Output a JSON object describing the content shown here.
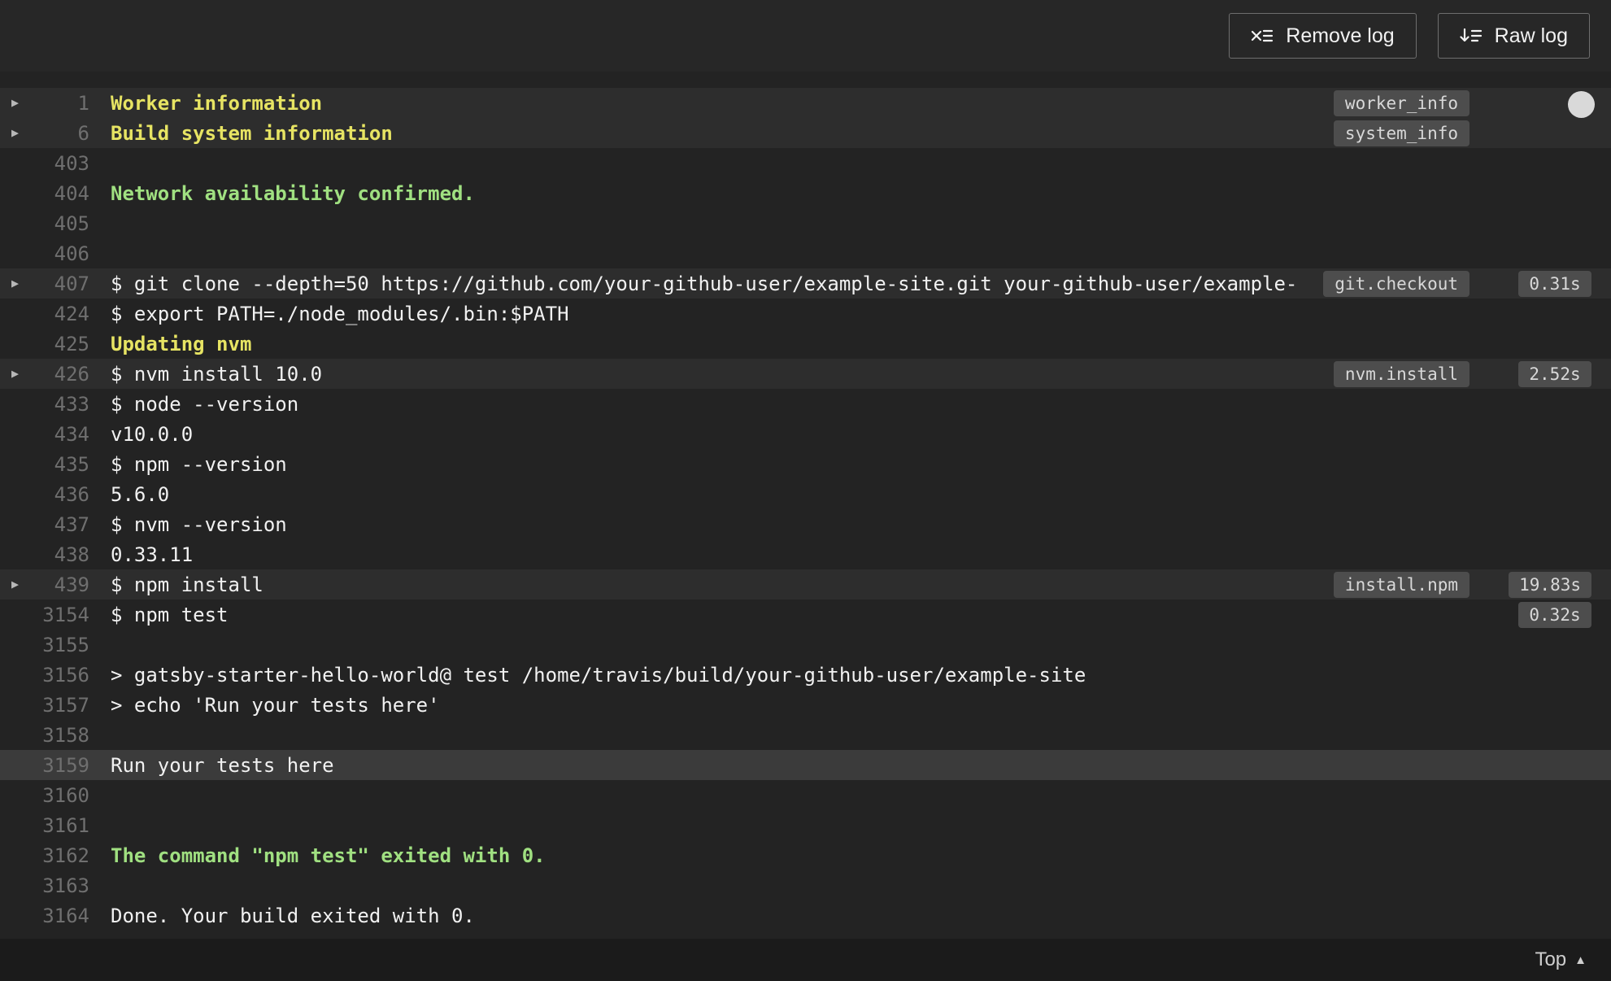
{
  "toolbar": {
    "remove_log": "Remove log",
    "raw_log": "Raw log"
  },
  "footer": {
    "top": "Top"
  },
  "colors": {
    "bg": "#232323",
    "header-bg": "#272727",
    "footer-bg": "#1b1b1b",
    "row-hl": "#2d2d2d",
    "row-sel": "#3b3b3b",
    "text": "#f1f1f1",
    "line-num": "#6f6f6f",
    "yellow": "#e7e463",
    "green": "#a0e081",
    "badge-bg": "#4d4d4d",
    "badge-text": "#d8d8d8"
  },
  "log": {
    "lines": [
      {
        "num": "1",
        "text": "Worker information",
        "style": "yellow",
        "fold": true,
        "badge": "worker_info",
        "highlight": true
      },
      {
        "num": "6",
        "text": "Build system information",
        "style": "yellow",
        "fold": true,
        "badge": "system_info",
        "highlight": true
      },
      {
        "num": "403",
        "text": ""
      },
      {
        "num": "404",
        "text": "Network availability confirmed.",
        "style": "green"
      },
      {
        "num": "405",
        "text": ""
      },
      {
        "num": "406",
        "text": ""
      },
      {
        "num": "407",
        "text": "$ git clone --depth=50 https://github.com/your-github-user/example-site.git your-github-user/example-",
        "fold": true,
        "badge": "git.checkout",
        "time": "0.31s",
        "highlight": true
      },
      {
        "num": "424",
        "text": "$ export PATH=./node_modules/.bin:$PATH"
      },
      {
        "num": "425",
        "text": "Updating nvm",
        "style": "yellow"
      },
      {
        "num": "426",
        "text": "$ nvm install 10.0",
        "fold": true,
        "badge": "nvm.install",
        "time": "2.52s",
        "highlight": true
      },
      {
        "num": "433",
        "text": "$ node --version"
      },
      {
        "num": "434",
        "text": "v10.0.0"
      },
      {
        "num": "435",
        "text": "$ npm --version"
      },
      {
        "num": "436",
        "text": "5.6.0"
      },
      {
        "num": "437",
        "text": "$ nvm --version"
      },
      {
        "num": "438",
        "text": "0.33.11"
      },
      {
        "num": "439",
        "text": "$ npm install",
        "fold": true,
        "badge": "install.npm",
        "time": "19.83s",
        "highlight": true
      },
      {
        "num": "3154",
        "text": "$ npm test",
        "time": "0.32s"
      },
      {
        "num": "3155",
        "text": ""
      },
      {
        "num": "3156",
        "text": "> gatsby-starter-hello-world@ test /home/travis/build/your-github-user/example-site"
      },
      {
        "num": "3157",
        "text": "> echo 'Run your tests here'"
      },
      {
        "num": "3158",
        "text": ""
      },
      {
        "num": "3159",
        "text": "Run your tests here",
        "selected": true
      },
      {
        "num": "3160",
        "text": ""
      },
      {
        "num": "3161",
        "text": ""
      },
      {
        "num": "3162",
        "text": "The command \"npm test\" exited with 0.",
        "style": "green"
      },
      {
        "num": "3163",
        "text": ""
      },
      {
        "num": "3164",
        "text": "Done. Your build exited with 0."
      }
    ]
  }
}
